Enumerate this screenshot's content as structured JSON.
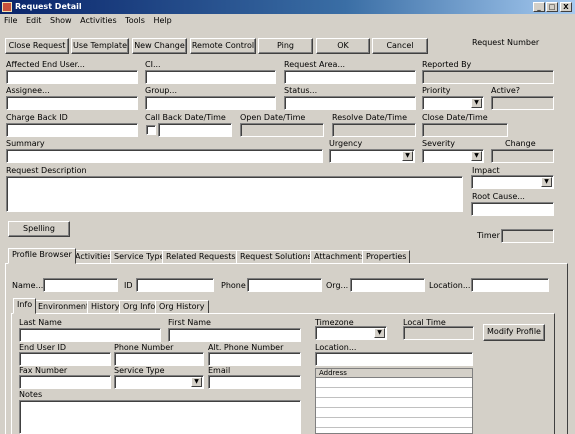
{
  "window": {
    "title": "Request Detail",
    "controls": [
      "_",
      "□",
      "X"
    ]
  },
  "menu": [
    "File",
    "Edit",
    "Show",
    "Activities",
    "Tools",
    "Help"
  ],
  "toolbar": {
    "close_request": "Close Request",
    "use_template": "Use Template",
    "new_change": "New Change",
    "remote_control": "Remote Control",
    "ping": "Ping",
    "ok": "OK",
    "cancel": "Cancel",
    "request_number_label": "Request Number"
  },
  "form": {
    "affected_end_user": "Affected End User...",
    "ci": "CI...",
    "request_area": "Request Area...",
    "reported_by": "Reported By",
    "assignee": "Assignee...",
    "group": "Group...",
    "status": "Status...",
    "priority": "Priority",
    "active": "Active?",
    "charge_back_id": "Charge Back ID",
    "call_back_datetime": "Call Back Date/Time",
    "open_datetime": "Open Date/Time",
    "resolve_datetime": "Resolve Date/Time",
    "close_datetime": "Close Date/Time",
    "summary": "Summary",
    "urgency": "Urgency",
    "severity": "Severity",
    "change": "Change",
    "request_description": "Request Description",
    "impact": "Impact",
    "root_cause": "Root Cause...",
    "timer": "Timer",
    "spelling": "Spelling"
  },
  "tabs": [
    "Profile Browser",
    "Activities",
    "Service Type",
    "Related Requests",
    "Request Solutions",
    "Attachments",
    "Properties"
  ],
  "profile": {
    "name": "Name...",
    "id": "ID",
    "phone": "Phone",
    "org": "Org...",
    "location": "Location..."
  },
  "subtabs": [
    "Info",
    "Environment",
    "History",
    "Org Info",
    "Org History"
  ],
  "info": {
    "last_name": "Last Name",
    "first_name": "First Name",
    "timezone": "Timezone",
    "local_time": "Local Time",
    "modify_profile": "Modify Profile",
    "end_user_id": "End User ID",
    "phone_number": "Phone Number",
    "alt_phone_number": "Alt. Phone Number",
    "location": "Location...",
    "fax_number": "Fax Number",
    "service_type": "Service Type",
    "email": "Email",
    "address": "Address",
    "notes": "Notes"
  }
}
